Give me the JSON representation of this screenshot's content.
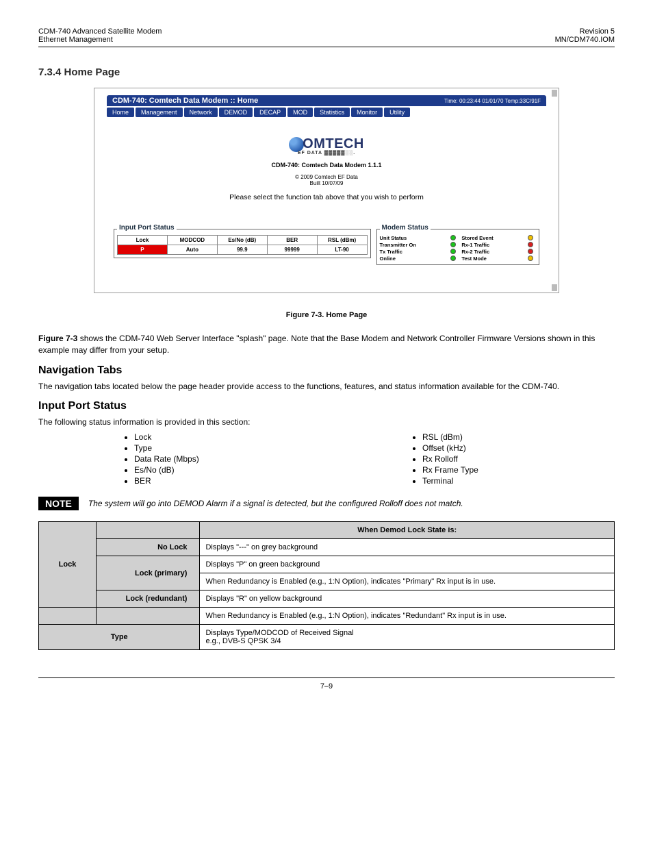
{
  "doc_header": {
    "left_line1": "CDM-740 Advanced Satellite Modem",
    "left_line2": "Ethernet Management",
    "right_line1": "Revision 5",
    "right_line2": "MN/CDM740.IOM"
  },
  "section_title": "7.3.4  Home Page",
  "app": {
    "titlebar": "CDM-740: Comtech Data Modem :: Home",
    "time_temp": "Time: 00:23:44 01/01/70 Temp:33C/91F",
    "tabs": [
      "Home",
      "Management",
      "Network",
      "DEMOD",
      "DECAP",
      "MOD",
      "Statistics",
      "Monitor",
      "Utility"
    ],
    "brand_upper": "OMTECH",
    "brand_sub": "EF DATA ▓▓▓▓▓░░.",
    "subline1": "CDM-740: Comtech Data Modem 1.1.1",
    "subline2": "© 2009 Comtech EF Data",
    "subline3": "Built 10/07/09",
    "prompt": "Please select the function tab above that you wish to perform"
  },
  "ips": {
    "legend": "Input Port Status",
    "headers": [
      "Lock",
      "MODCOD",
      "Es/No (dB)",
      "BER",
      "RSL (dBm)"
    ],
    "row": {
      "lock_label": "P",
      "modcod": "Auto",
      "esno": "99.9",
      "ber": "99999",
      "rsl": "LT-90"
    }
  },
  "ms": {
    "legend": "Modem Status",
    "rows": [
      [
        "Unit Status",
        "green",
        "Stored Event",
        "yellow"
      ],
      [
        "Transmitter On",
        "green",
        "Rx-1 Traffic",
        "red"
      ],
      [
        "Tx Traffic",
        "green",
        "Rx-2 Traffic",
        "red"
      ],
      [
        "Online",
        "green",
        "Test Mode",
        "yellow"
      ]
    ]
  },
  "fig_caption": "Figure 7-3. Home Page",
  "para": {
    "intro_strong_1": "Figure 7-3",
    "intro_1": " shows the CDM-740 Web Server Interface \"splash\" page. Note that the Base Modem and Network Controller Firmware Versions shown in this example may differ from your setup.",
    "nav_head": "Navigation Tabs",
    "intro_2": "The navigation tabs located below the page header provide access to the functions, features, and status information available for the CDM-740.",
    "ips_head": "Input Port Status",
    "ips_body": "The following status information is provided in this section:"
  },
  "bullets_left": [
    "Lock",
    "Type",
    "Data Rate (Mbps)",
    "Es/No (dB)",
    "BER"
  ],
  "bullets_right": [
    "RSL (dBm)",
    "Offset (kHz)",
    "Rx Rolloff",
    "Rx Frame Type",
    "Terminal"
  ],
  "note": {
    "tag": "NOTE",
    "body": "The system will go into DEMOD Alarm if a signal is detected, but the configured Rolloff does not match."
  },
  "table1": {
    "col1_header": "Lock",
    "col2_header": "When Demod Lock State is:",
    "r1c1": "No Lock",
    "r1c2": "Displays \"---\" on grey background",
    "r2c1": "Lock (primary)",
    "r2c2_l1": "Displays \"P\" on green background",
    "r2c2_l2": "When Redundancy is Enabled (e.g., 1:N Option), indicates \"Primary\" Rx input is in use.",
    "r3c1": "Lock (redundant)",
    "r3c2": "Displays \"R\" on yellow background",
    "r4c1": "",
    "r4c2": "When Redundancy is Enabled (e.g., 1:N Option), indicates \"Redundant\" Rx input is in use.",
    "row2_c1": "Type",
    "row2_c2_l1": "Displays Type/MODCOD of Received Signal",
    "row2_c2_l2": "e.g., DVB-S QPSK 3/4"
  },
  "footer": "7–9"
}
